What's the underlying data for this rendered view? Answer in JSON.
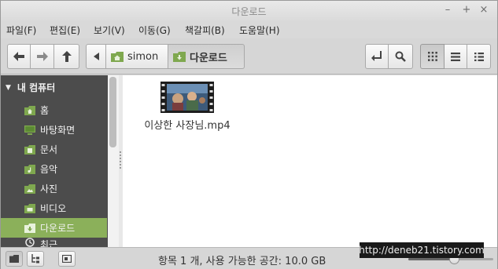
{
  "window": {
    "title": "다운로드"
  },
  "menubar": {
    "items": [
      "파일(F)",
      "편집(E)",
      "보기(V)",
      "이동(G)",
      "책갈피(B)",
      "도움말(H)"
    ]
  },
  "toolbar": {
    "back_icon": "arrow-left-icon",
    "forward_icon": "arrow-right-icon",
    "up_icon": "arrow-up-icon",
    "breadcrumb": [
      {
        "label": "simon",
        "icon": "home-folder-icon"
      },
      {
        "label": "다운로드",
        "icon": "download-folder-icon",
        "active": true
      }
    ]
  },
  "sidebar": {
    "header": "내 컴퓨터",
    "items": [
      {
        "label": "홈",
        "icon": "home-folder-icon"
      },
      {
        "label": "바탕화면",
        "icon": "desktop-icon"
      },
      {
        "label": "문서",
        "icon": "documents-folder-icon"
      },
      {
        "label": "음악",
        "icon": "music-folder-icon"
      },
      {
        "label": "사진",
        "icon": "pictures-folder-icon"
      },
      {
        "label": "비디오",
        "icon": "videos-folder-icon"
      },
      {
        "label": "다운로드",
        "icon": "download-folder-icon",
        "selected": true
      },
      {
        "label": "최근",
        "icon": "recent-icon"
      }
    ]
  },
  "files": [
    {
      "name": "이상한 사장님.mp4",
      "icon": "video-thumbnail"
    }
  ],
  "statusbar": {
    "text": "항목 1 개, 사용 가능한 공간: 10.0 GB",
    "zoom_level": 0.55
  },
  "watermark": "http://deneb21.tistory.com",
  "colors": {
    "accent": "#8bb05a",
    "sidebar_bg": "#4c4c4c",
    "folder": "#7fa84f"
  }
}
